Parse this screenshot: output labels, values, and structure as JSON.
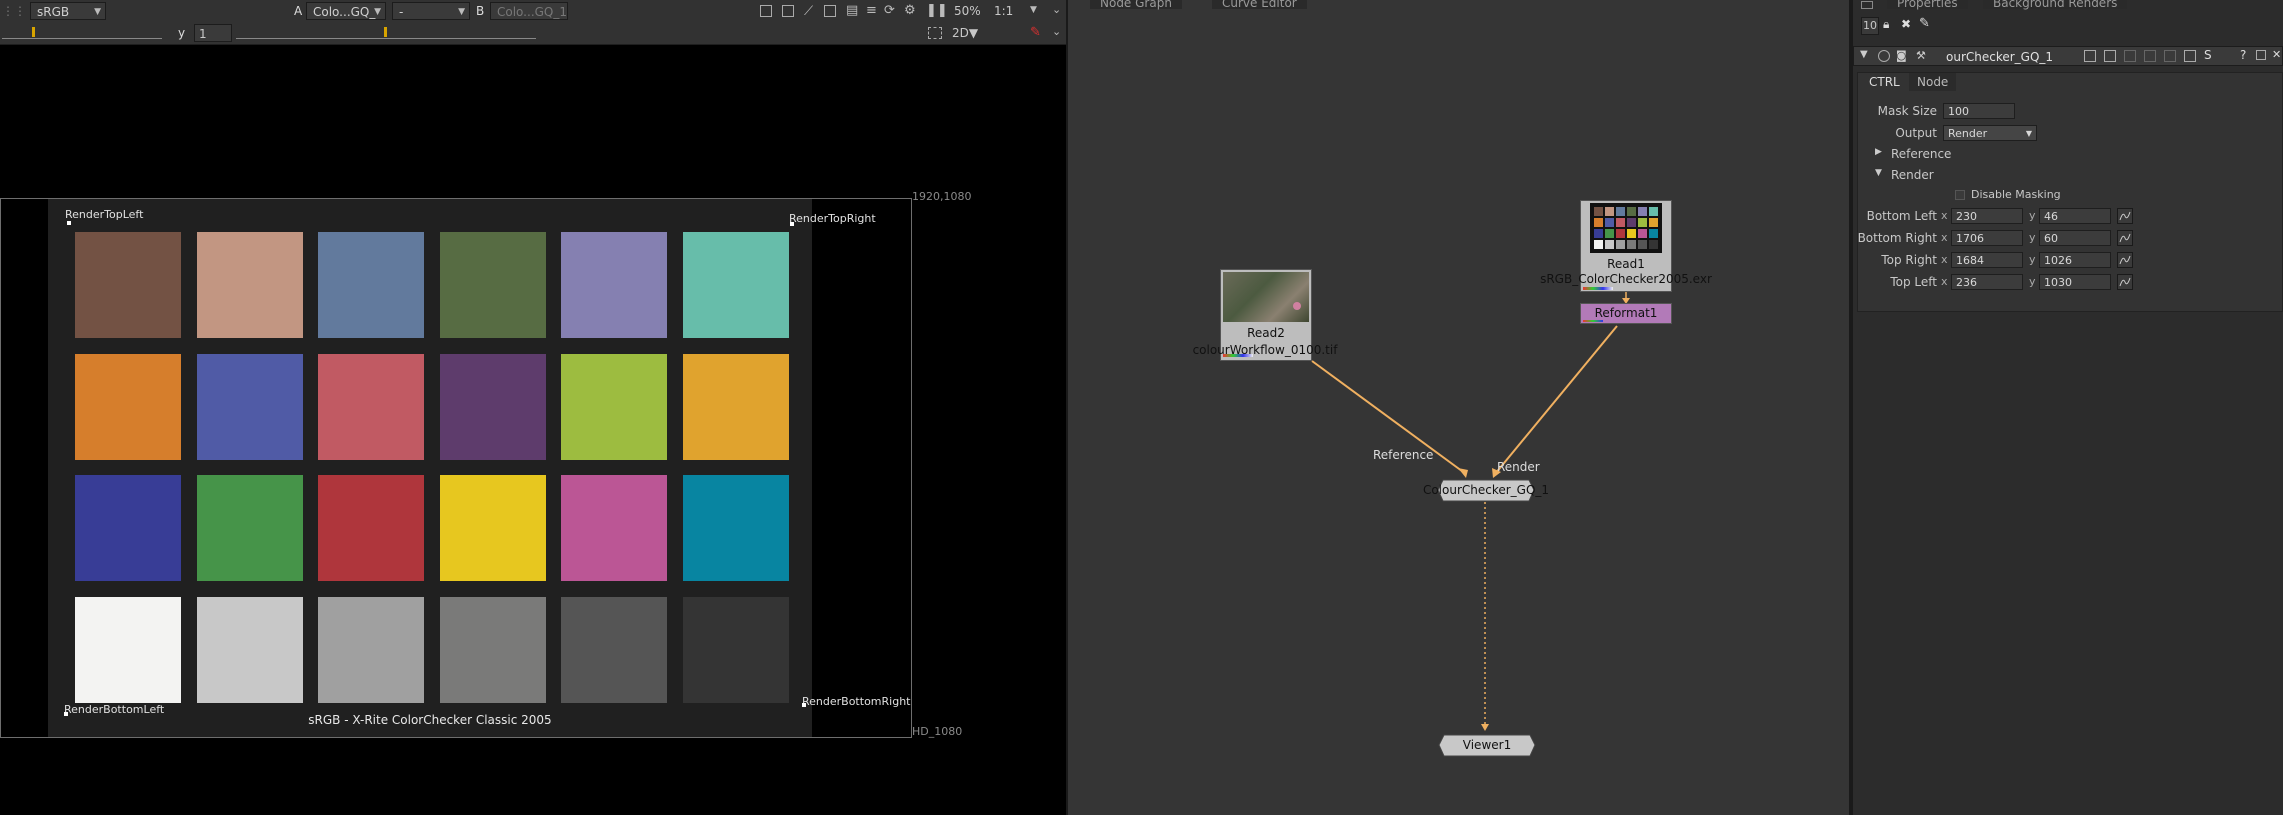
{
  "viewer": {
    "toolbar1": {
      "colorspace": "sRGB",
      "input_a_label": "A",
      "input_a": "Colo...GQ_",
      "input_a_layer": "-",
      "input_b_label": "B",
      "input_b": "Colo...GQ_1",
      "zoom": "50%",
      "proxy": "1:1"
    },
    "toolbar2": {
      "y_label": "y",
      "y_value": "1",
      "view_mode": "2D"
    },
    "format_label_top": "1920,1080",
    "format_label_bottom": "HD_1080",
    "corner_labels": {
      "top_left": "RenderTopLeft",
      "top_right": "RenderTopRight",
      "bottom_left": "RenderBottomLeft",
      "bottom_right": "RenderBottomRight"
    },
    "chart_caption": "sRGB - X-Rite ColorChecker Classic 2005",
    "swatches": [
      [
        "#735244",
        "#c29682",
        "#627a9d",
        "#576c43",
        "#8580b1",
        "#67bdaa"
      ],
      [
        "#d67e2c",
        "#505ba6",
        "#c15a63",
        "#5e3c6c",
        "#9dbc40",
        "#e0a32e"
      ],
      [
        "#383d96",
        "#469449",
        "#af363c",
        "#e7c71f",
        "#bb5695",
        "#0885a1"
      ],
      [
        "#f3f3f2",
        "#c8c8c8",
        "#a0a0a0",
        "#7a7a79",
        "#555555",
        "#343434"
      ]
    ]
  },
  "graph": {
    "tabs": [
      "Node Graph",
      "Curve Editor"
    ],
    "nodes": {
      "read2": {
        "name": "Read2",
        "file": "colourWorkflow_0100.tif"
      },
      "read1": {
        "name": "Read1",
        "file": "sRGB_ColorChecker2005.exr"
      },
      "reformat": {
        "name": "Reformat1"
      },
      "colorchecker": {
        "name": "ColourChecker_GQ_1",
        "input_reference": "Reference",
        "input_render": "Render"
      },
      "viewer": {
        "name": "Viewer1"
      }
    },
    "colors": {
      "pipe": "#f0b060",
      "reformat": "#b27ab8"
    }
  },
  "properties": {
    "tabs": [
      "Properties",
      "Background Renders"
    ],
    "max_panels": "10",
    "node_name": "ourChecker_GQ_1",
    "subtabs": [
      "CTRL",
      "Node"
    ],
    "mask_size_label": "Mask Size",
    "mask_size": "100",
    "output_label": "Output",
    "output": "Render",
    "reference_label": "Reference",
    "render_label": "Render",
    "disable_masking_label": "Disable Masking",
    "corners": [
      {
        "label": "Bottom Left",
        "x": "230",
        "y": "46"
      },
      {
        "label": "Bottom Right",
        "x": "1706",
        "y": "60"
      },
      {
        "label": "Top Right",
        "x": "1684",
        "y": "1026"
      },
      {
        "label": "Top Left",
        "x": "236",
        "y": "1030"
      }
    ],
    "x_label": "x",
    "y_label": "y"
  }
}
